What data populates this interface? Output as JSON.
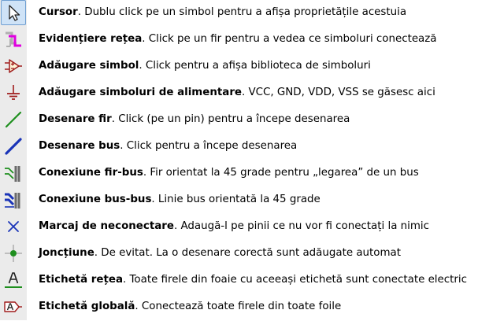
{
  "tools": [
    {
      "icon": "cursor-arrow-icon",
      "name": "Cursor",
      "text": ". Dublu click pe un simbol pentru a afișa proprietățile acestuia",
      "selected": true
    },
    {
      "icon": "highlight-net-icon",
      "name": "Evidențiere rețea",
      "text": ". Click pe un fir pentru a vedea ce simboluri conectează",
      "selected": false
    },
    {
      "icon": "add-symbol-icon",
      "name": "Adăugare simbol",
      "text": ". Click pentru a afișa biblioteca de simboluri",
      "selected": false
    },
    {
      "icon": "power-symbol-ground-icon",
      "name": "Adăugare simboluri de alimentare",
      "text": ". VCC, GND, VDD, VSS se găsesc aici",
      "selected": false
    },
    {
      "icon": "draw-wire-icon",
      "name": "Desenare fir",
      "text": ". Click (pe un pin) pentru a începe desenarea",
      "selected": false
    },
    {
      "icon": "draw-bus-icon",
      "name": "Desenare bus",
      "text": ". Click pentru a începe desenarea",
      "selected": false
    },
    {
      "icon": "wire-bus-entry-icon",
      "name": "Conexiune fir-bus",
      "text": ". Fir orientat la 45 grade pentru „legarea” de un bus",
      "selected": false
    },
    {
      "icon": "bus-bus-entry-icon",
      "name": "Conexiune bus-bus",
      "text": ". Linie bus orientată la 45 grade",
      "selected": false
    },
    {
      "icon": "no-connect-flag-icon",
      "name": "Marcaj de neconectare",
      "text": ". Adaugă-l pe pinii ce nu vor fi conectați la nimic",
      "selected": false
    },
    {
      "icon": "junction-dot-icon",
      "name": "Joncțiune",
      "text": ". De evitat. La o desenare corectă sunt adăugate automat",
      "selected": false
    },
    {
      "icon": "net-label-icon",
      "name": "Etichetă rețea",
      "text": ". Toate firele din foaie cu aceeași etichetă sunt conectate electric",
      "selected": false
    },
    {
      "icon": "global-label-icon",
      "name": "Etichetă globală",
      "text": ". Conectează toate firele din toate foile",
      "selected": false
    }
  ],
  "colors": {
    "wire": "#1e8f1e",
    "bus": "#1a34b8",
    "symbol": "#a01c1c",
    "selection": "#cfe3f7",
    "toolbar": "#ebebeb"
  }
}
